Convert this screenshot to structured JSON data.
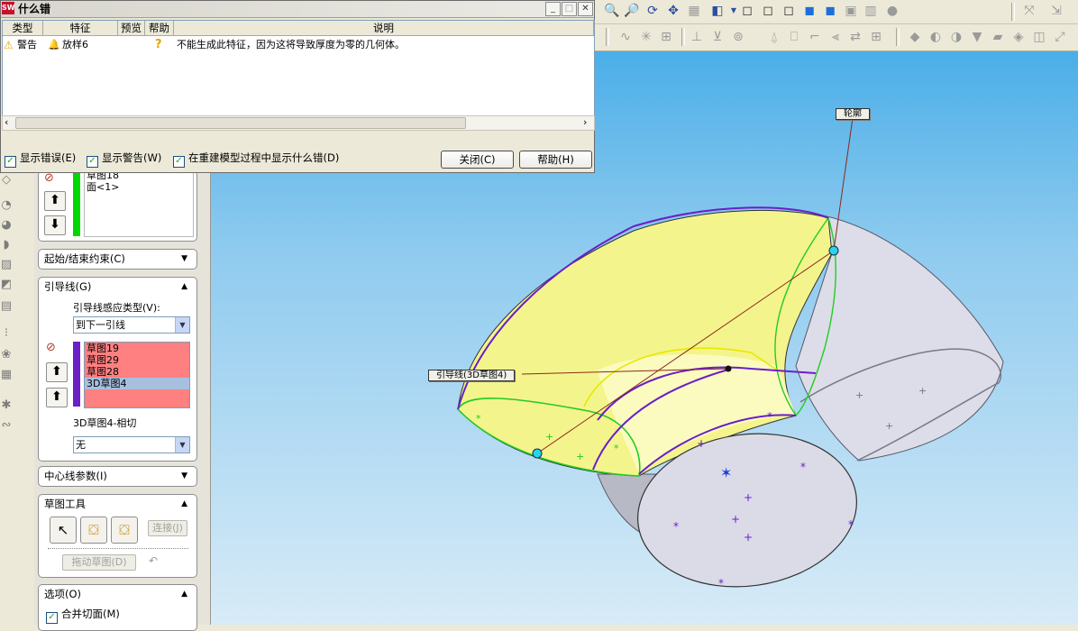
{
  "dialog": {
    "title": "什么错",
    "app_logo": "SW",
    "columns": [
      "类型",
      "特征",
      "预览",
      "帮助",
      "说明"
    ],
    "rows": [
      {
        "type": "警告",
        "feature": "放样6",
        "help": "?",
        "description": "不能生成此特征，因为这将导致厚度为零的几何体。"
      }
    ],
    "checkboxes": {
      "show_errors": "显示错误(E)",
      "show_warnings": "显示警告(W)",
      "show_rebuild": "在重建模型过程中显示什么错(D)"
    },
    "buttons": {
      "close": "关闭(C)",
      "help": "帮助(H)"
    }
  },
  "panel": {
    "profile_list": [
      "草图18",
      "面<1>"
    ],
    "start_end": "起始/结束约束(C)",
    "guides": {
      "title": "引导线(G)",
      "influence_label": "引导线感应类型(V):",
      "influence_value": "到下一引线",
      "items": [
        "草图19",
        "草图29",
        "草图28",
        "3D草图4"
      ],
      "tangency_label": "3D草图4-相切",
      "tangency_value": "无"
    },
    "centerline": "中心线参数(I)",
    "sketch_tools": {
      "title": "草图工具",
      "connect": "连接(J)",
      "drag": "拖动草图(D)"
    },
    "options": {
      "title": "选项(O)",
      "merge": "合并切面(M)"
    }
  },
  "viewport": {
    "callout_profile": "轮廓",
    "callout_guide": "引导线(3D草图4)"
  },
  "colors": {
    "viewport_top": "#4aaee8",
    "viewport_bottom": "#d8ebf7",
    "guide_line": "#6a1fc7",
    "profile_line": "#22cc22",
    "body_fill": "#f4f48c",
    "list_highlight": "#ff8080",
    "list_selected": "#a8c0e0"
  }
}
